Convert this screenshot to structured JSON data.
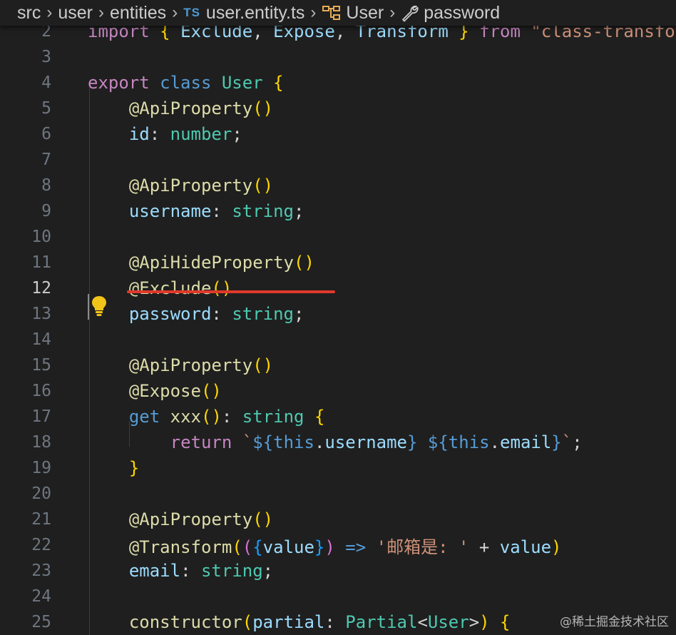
{
  "breadcrumb": {
    "items": [
      "src",
      "user",
      "entities",
      "user.entity.ts",
      "User",
      "password"
    ],
    "file_type_badge": "TS",
    "icons": [
      "chevron-right-icon",
      "class-symbol-icon",
      "property-wrench-icon"
    ]
  },
  "editor": {
    "language": "typescript",
    "active_line": "12",
    "lines": [
      {
        "n": "2",
        "text": "import { Exclude, Expose, Transform } from \"class-transfo"
      },
      {
        "n": "3",
        "text": ""
      },
      {
        "n": "4",
        "text": "export class User {"
      },
      {
        "n": "5",
        "text": "    @ApiProperty()"
      },
      {
        "n": "6",
        "text": "    id: number;"
      },
      {
        "n": "7",
        "text": ""
      },
      {
        "n": "8",
        "text": "    @ApiProperty()"
      },
      {
        "n": "9",
        "text": "    username: string;"
      },
      {
        "n": "10",
        "text": ""
      },
      {
        "n": "11",
        "text": "    @ApiHideProperty()"
      },
      {
        "n": "12",
        "text": "    @Exclude()"
      },
      {
        "n": "13",
        "text": "    password: string;"
      },
      {
        "n": "14",
        "text": ""
      },
      {
        "n": "15",
        "text": "    @ApiProperty()"
      },
      {
        "n": "16",
        "text": "    @Expose()"
      },
      {
        "n": "17",
        "text": "    get xxx(): string {"
      },
      {
        "n": "18",
        "text": "        return `${this.username} ${this.email}`;"
      },
      {
        "n": "19",
        "text": "    }"
      },
      {
        "n": "20",
        "text": ""
      },
      {
        "n": "21",
        "text": "    @ApiProperty()"
      },
      {
        "n": "22",
        "text": "    @Transform(({value}) => '邮箱是: ' + value)"
      },
      {
        "n": "23",
        "text": "    email: string;"
      },
      {
        "n": "24",
        "text": ""
      },
      {
        "n": "25",
        "text": "    constructor(partial: Partial<User>) {"
      }
    ]
  },
  "annotation": {
    "underlined_line": "11",
    "color": "#e0392b"
  },
  "code_action_icon": "lightbulb-icon",
  "watermark": "@稀土掘金技术社区",
  "colors": {
    "background": "#1f1f1f",
    "keyword": "#c586c0",
    "storage": "#569cd6",
    "type": "#4ec9b0",
    "function": "#dcdcaa",
    "variable": "#9cdcfe",
    "string": "#ce9178",
    "bracket_gold": "#ffd700",
    "bracket_pink": "#da70d6"
  }
}
